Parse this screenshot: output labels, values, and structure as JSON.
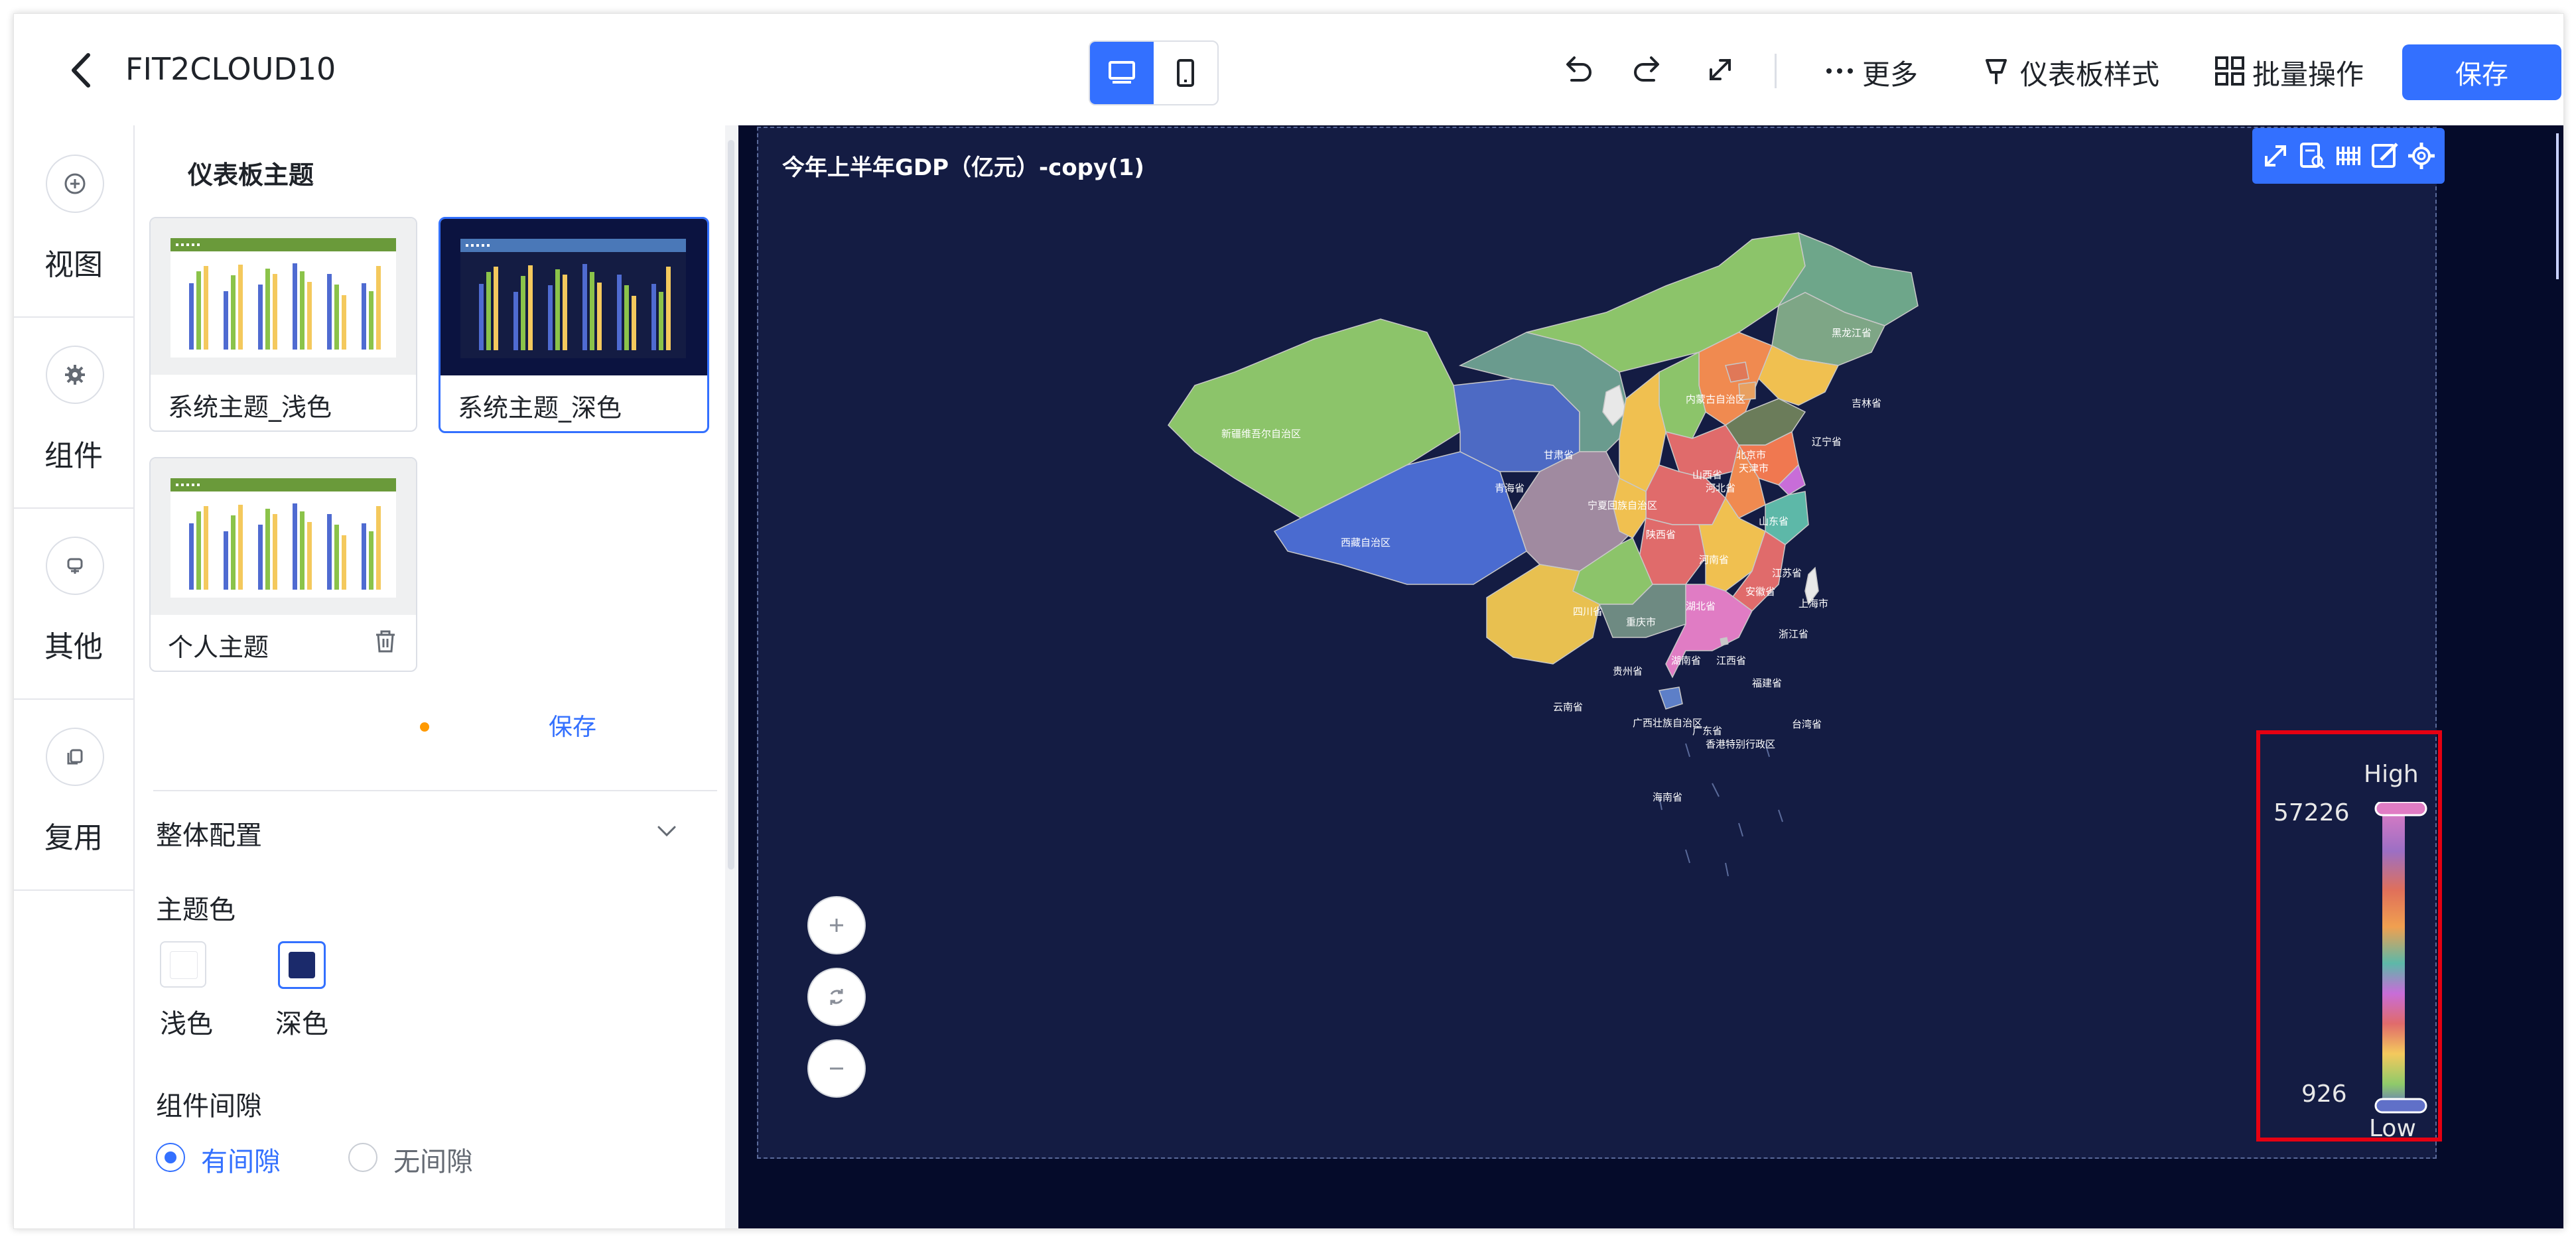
{
  "topbar": {
    "title": "FIT2CLOUD10",
    "more_label": "更多",
    "dashboard_style_label": "仪表板样式",
    "batch_label": "批量操作",
    "save_label": "保存"
  },
  "nav": {
    "items": [
      {
        "label": "视图",
        "icon": "plus-circle-icon"
      },
      {
        "label": "组件",
        "icon": "gear-icon"
      },
      {
        "label": "其他",
        "icon": "other-icon"
      },
      {
        "label": "复用",
        "icon": "copy-icon"
      }
    ]
  },
  "panel": {
    "section_title": "仪表板主题",
    "themes": [
      {
        "label": "系统主题_浅色"
      },
      {
        "label": "系统主题_深色"
      },
      {
        "label": "个人主题"
      }
    ],
    "save_label": "保存",
    "config_title": "整体配置",
    "theme_color_label": "主题色",
    "light_label": "浅色",
    "dark_label": "深色",
    "gap_label": "组件间隙",
    "with_gap_label": "有间隙",
    "no_gap_label": "无间隙"
  },
  "chart": {
    "title": "今年上半年GDP（亿元）-copy(1)",
    "legend": {
      "high_label": "High",
      "low_label": "Low",
      "max": "57226",
      "min": "926"
    }
  },
  "provinces": {
    "xinjiang": "新疆维吾尔自治区",
    "xizang": "西藏自治区",
    "qinghai": "青海省",
    "gansu": "甘肃省",
    "neimenggu": "内蒙古自治区",
    "heilongjiang": "黑龙江省",
    "jilin": "吉林省",
    "liaoning": "辽宁省",
    "beijing": "北京市",
    "tianjin": "天津市",
    "hebei": "河北省",
    "shanxi": "山西省",
    "shandong": "山东省",
    "ningxia": "宁夏回族自治区",
    "shaanxi": "陕西省",
    "henan": "河南省",
    "jiangsu": "江苏省",
    "anhui": "安徽省",
    "shanghai": "上海市",
    "hubei": "湖北省",
    "sichuan": "四川省",
    "chongqing": "重庆市",
    "zhejiang": "浙江省",
    "hunan": "湖南省",
    "jiangxi": "江西省",
    "guizhou": "贵州省",
    "fujian": "福建省",
    "yunnan": "云南省",
    "guangxi": "广西壮族自治区",
    "guangdong": "广东省",
    "taiwan": "台湾省",
    "xianggang": "香港特别行政区",
    "hainan": "海南省"
  },
  "colors": {
    "accent": "#3370ff",
    "canvas_bg": "#050b2a",
    "card_bg": "#141c43",
    "highlight_border": "#e60012",
    "legend_gradient": [
      "#e07cc4",
      "#9c6fc4",
      "#e0705a",
      "#f0a050",
      "#5db8a8",
      "#c86dd8",
      "#e06b6b",
      "#f4c95d",
      "#8fca6a",
      "#6070c8"
    ]
  }
}
